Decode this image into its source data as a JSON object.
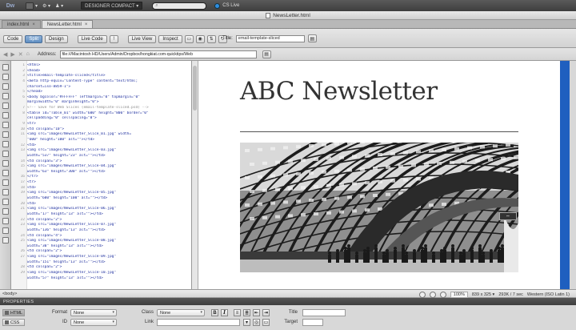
{
  "appbar": {
    "logo": "Dw",
    "workspace": "DESIGNER COMPACT ▾",
    "search_placeholder": "",
    "cslive": "CS Live",
    "menu_symbols": [
      "▾",
      "⚙ ▾",
      "♟ ▾"
    ]
  },
  "window": {
    "title": "NewsLetter.html"
  },
  "tabs": [
    {
      "label": "index.html",
      "close": "×"
    },
    {
      "label": "NewsLetter.html",
      "close": "×"
    }
  ],
  "doc_toolbar": {
    "view_buttons": [
      "Code",
      "Split",
      "Design"
    ],
    "live_code": "Live Code",
    "live_view": "Live View",
    "inspect": "Inspect",
    "title_label": "Title:",
    "title_value": "email-template-sliced"
  },
  "address_bar": {
    "label": "Address:",
    "value": "file:///Macintosh HD/Users/Admin/Dropbox/hongkiat.com-quicktips/Web"
  },
  "code_lines": [
    {
      "n": "1",
      "t": "<html>",
      "c": ""
    },
    {
      "n": "2",
      "t": "<head>",
      "c": ""
    },
    {
      "n": "3",
      "t": "<title>email-template-sliced</title>",
      "c": ""
    },
    {
      "n": "4",
      "t": "<meta http-equiv=\"Content-Type\" content=\"text/html;",
      "c": ""
    },
    {
      "n": "",
      "t": "charset=iso-8859-1\">",
      "c": ""
    },
    {
      "n": "5",
      "t": "</head>",
      "c": ""
    },
    {
      "n": "6",
      "t": "<body bgcolor=\"#FFFFFF\" leftmargin=\"0\" topmargin=\"0\"",
      "c": ""
    },
    {
      "n": "",
      "t": "marginwidth=\"0\" marginheight=\"0\">",
      "c": ""
    },
    {
      "n": "7",
      "t": "<!-- Save for Web Slices (email-template-sliced.psd) -->",
      "c": "cm"
    },
    {
      "n": "8",
      "t": "<table id=\"Table_01\" width=\"600\" height=\"800\" border=\"0\"",
      "c": ""
    },
    {
      "n": "",
      "t": "cellpadding=\"0\" cellspacing=\"0\">",
      "c": ""
    },
    {
      "n": "9",
      "t": "  <tr>",
      "c": ""
    },
    {
      "n": "10",
      "t": "    <td colspan=\"10\">",
      "c": ""
    },
    {
      "n": "11",
      "t": "      <img src=\"images/NewsLetter_Slice_01.jpg\" width=",
      "c": ""
    },
    {
      "n": "",
      "t": "\"600\" height=\"100\" alt=\"\"></td>",
      "c": ""
    },
    {
      "n": "12",
      "t": "    <td>",
      "c": ""
    },
    {
      "n": "13",
      "t": "      <img src=\"images/NewsLetter_Slice-03.jpg\"",
      "c": ""
    },
    {
      "n": "",
      "t": "width=\"537\" height=\"23\" alt=\"\"></td>",
      "c": ""
    },
    {
      "n": "14",
      "t": "    <td colspan=\"3\">",
      "c": ""
    },
    {
      "n": "15",
      "t": "      <img src=\"images/NewsLetter_Slice-04.jpg\"",
      "c": ""
    },
    {
      "n": "",
      "t": "width=\"63\" height=\"300\" alt=\"\"></td>",
      "c": ""
    },
    {
      "n": "16",
      "t": "  </tr>",
      "c": ""
    },
    {
      "n": "17",
      "t": "  <tr>",
      "c": ""
    },
    {
      "n": "18",
      "t": "    <td>",
      "c": ""
    },
    {
      "n": "19",
      "t": "      <img src=\"images/NewsLetter_Slice-05.jpg\"",
      "c": ""
    },
    {
      "n": "",
      "t": "width=\"600\" height=\"100\" alt=\"\"></td>",
      "c": ""
    },
    {
      "n": "20",
      "t": "    <td>",
      "c": ""
    },
    {
      "n": "21",
      "t": "      <img src=\"images/NewsLetter_Slice-06.jpg\"",
      "c": ""
    },
    {
      "n": "",
      "t": "width=\"17\" height=\"13\" alt=\"\"></td>",
      "c": ""
    },
    {
      "n": "22",
      "t": "    <td colspan=\"2\">",
      "c": ""
    },
    {
      "n": "23",
      "t": "      <img src=\"images/NewsLetter_Slice-07.jpg\"",
      "c": ""
    },
    {
      "n": "",
      "t": "width=\"136\" height=\"13\" alt=\"\"></td>",
      "c": ""
    },
    {
      "n": "24",
      "t": "    <td colspan=\"4\">",
      "c": ""
    },
    {
      "n": "25",
      "t": "      <img src=\"images/NewsLetter_Slice-08.jpg\"",
      "c": ""
    },
    {
      "n": "",
      "t": "width=\"30\" height=\"13\" alt=\"\"></td>",
      "c": ""
    },
    {
      "n": "26",
      "t": "    <td colspan=\"2\">",
      "c": ""
    },
    {
      "n": "27",
      "t": "      <img src=\"images/NewsLetter_Slice-09.jpg\"",
      "c": ""
    },
    {
      "n": "",
      "t": "width=\"151\" height=\"13\" alt=\"\"></td>",
      "c": ""
    },
    {
      "n": "28",
      "t": "    <td colspan=\"2\">",
      "c": ""
    },
    {
      "n": "29",
      "t": "      <img src=\"images/NewsLetter_Slice-10.jpg\"",
      "c": ""
    },
    {
      "n": "",
      "t": "width=\"57\" height=\"13\" alt=\"\"></td>",
      "c": ""
    }
  ],
  "design": {
    "heading": "ABC Newsletter"
  },
  "statusbar": {
    "tag": "<body>",
    "zoom": "100%",
    "size": "839 x 325 ▾",
    "filesize": "293K / 7 sec",
    "encoding": "Western (ISO Latin 1)"
  },
  "properties": {
    "header": "PROPERTIES",
    "modes": [
      "HTML",
      "CSS"
    ],
    "format_label": "Format",
    "format_value": "None",
    "id_label": "ID",
    "id_value": "None",
    "class_label": "Class",
    "class_value": "None",
    "link_label": "Link",
    "bold": "B",
    "italic": "I",
    "title_label": "Title",
    "target_label": "Target"
  },
  "colors": {
    "accent_blue": "#1f5fbf",
    "split_pressed": "#5e8ec2"
  }
}
